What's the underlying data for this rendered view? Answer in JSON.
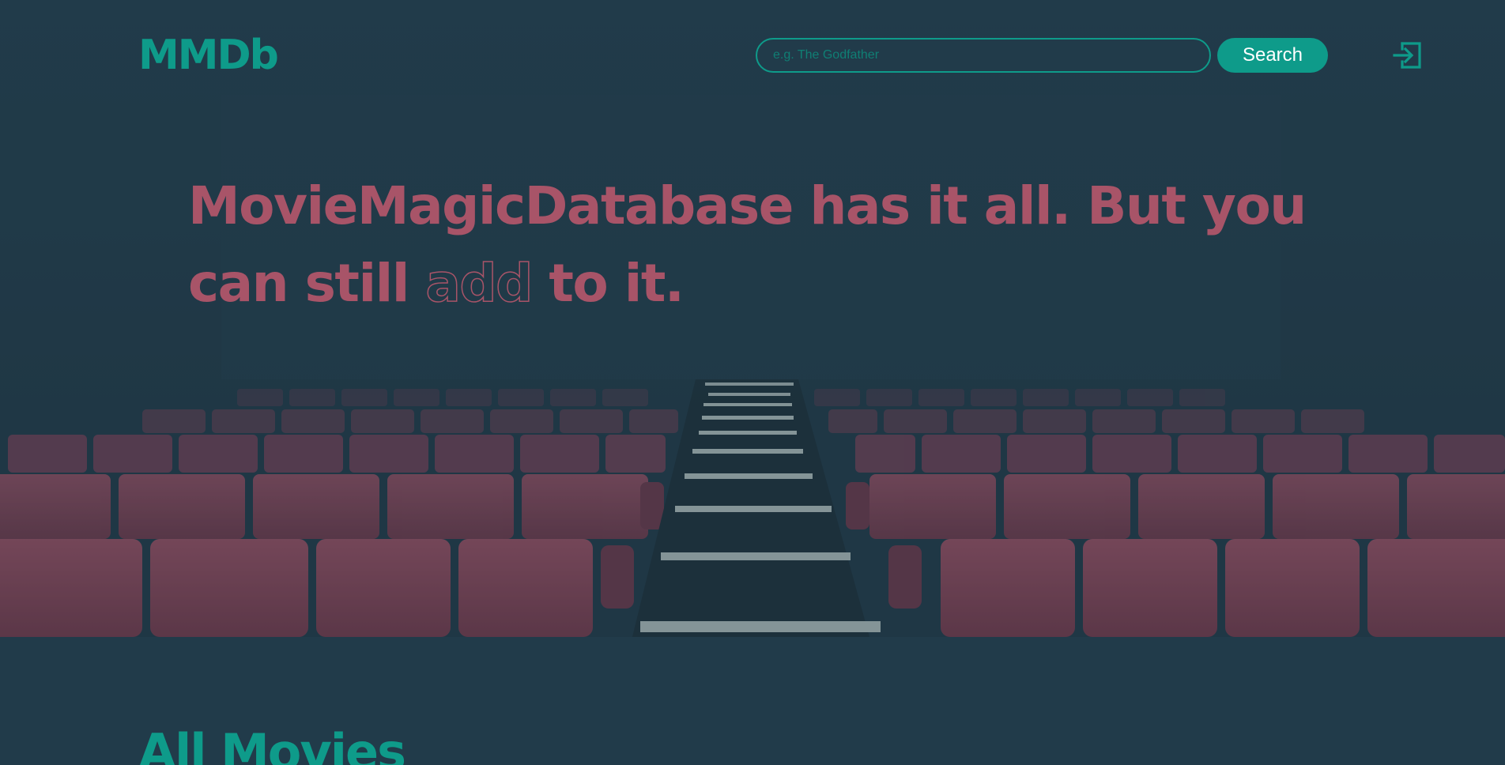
{
  "header": {
    "logo": "MMDb",
    "search": {
      "placeholder": "e.g. The Godfather",
      "value": ""
    },
    "search_button_label": "Search",
    "login_icon": "sign-in-icon"
  },
  "hero": {
    "headline_part1": "MovieMagicDatabase has it all. But you can still",
    "headline_outline": "add",
    "headline_part2": "to it.",
    "background_image": "empty-cinema-red-seats"
  },
  "main": {
    "section_title": "All Movies"
  },
  "colors": {
    "background": "#213b4a",
    "accent": "#0e9b8a",
    "headline": "#a85468",
    "seat": "#8a3f52"
  }
}
